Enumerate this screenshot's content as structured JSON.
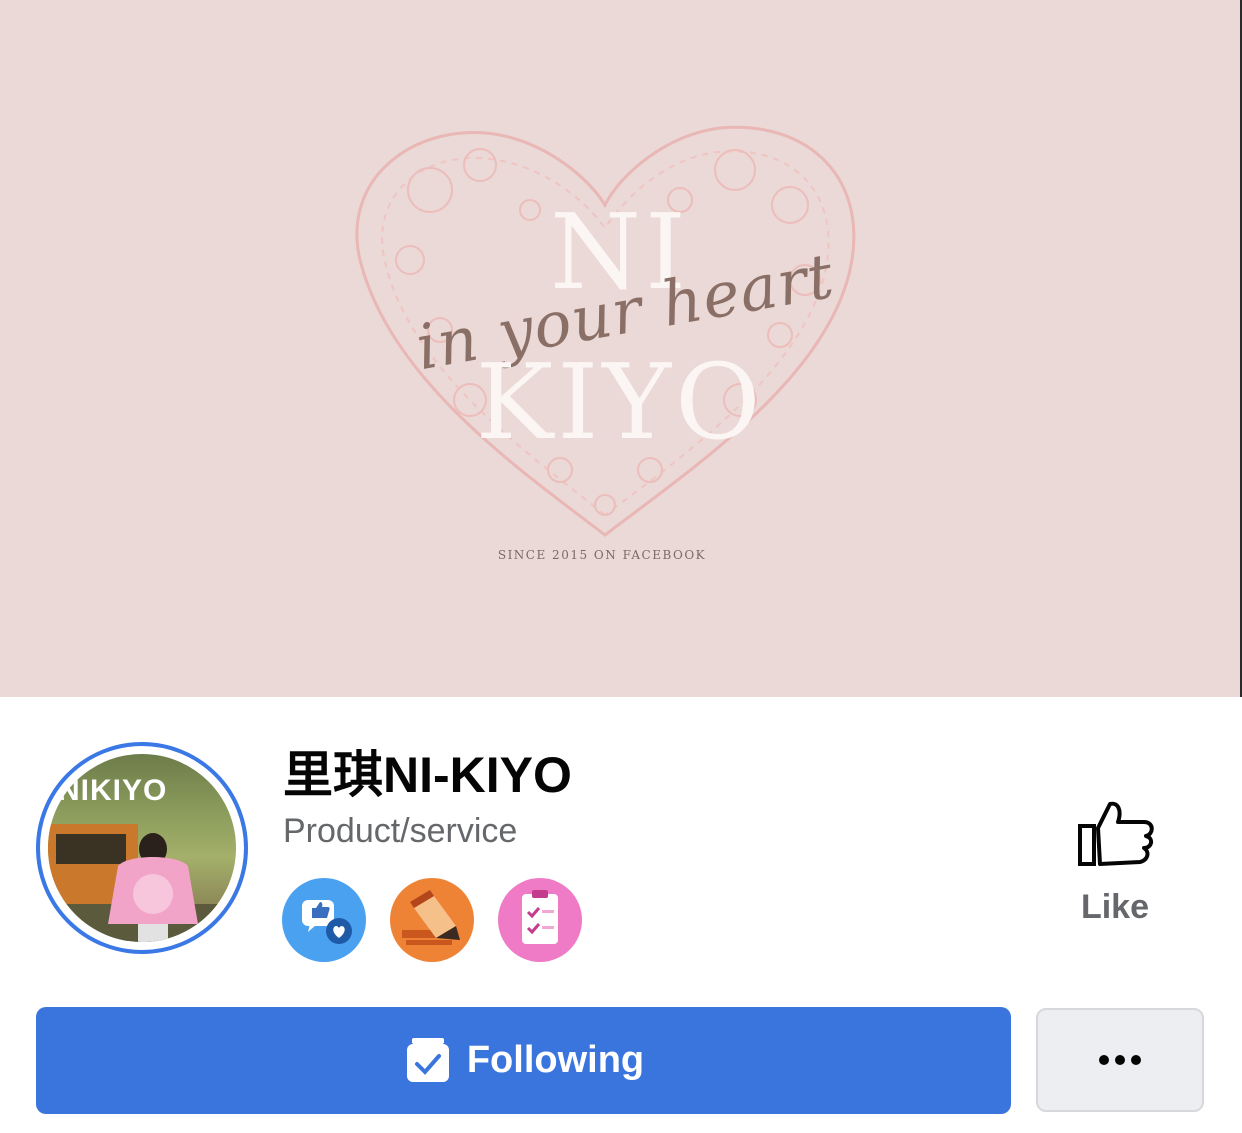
{
  "cover": {
    "line1": "NI",
    "script": "in your heart",
    "line2": "KIYO",
    "since": "SINCE 2015 ON FACEBOOK",
    "background_color": "#ead9d6",
    "pattern_color": "#e9b7b5"
  },
  "profile": {
    "avatar_text": "NIKIYO",
    "name": "里琪NI-KIYO",
    "category": "Product/service",
    "badges": [
      {
        "icon": "like-comment-badge-icon",
        "color": "#4aa1f0"
      },
      {
        "icon": "pencil-badge-icon",
        "color": "#ee8336"
      },
      {
        "icon": "checklist-badge-icon",
        "color": "#ef7bc6"
      }
    ]
  },
  "actions": {
    "like_label": "Like",
    "following_label": "Following",
    "more_icon": "more-dots-icon",
    "accent_color": "#3a75de"
  }
}
